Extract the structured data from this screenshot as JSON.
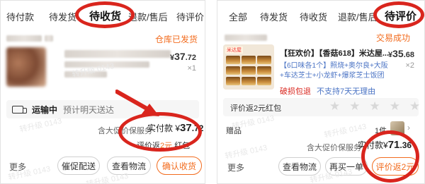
{
  "left": {
    "tabs": [
      "待付款",
      "待发货",
      "待收货",
      "退款/售后",
      "待评价"
    ],
    "status": "仓库已发货",
    "price": {
      "symbol": "¥",
      "integer": "37",
      "decimal": ".72"
    },
    "qty": "×1",
    "delivery": {
      "label": "运输中",
      "note": "预计明天送达"
    },
    "paid": {
      "prefix": "含大促价保服务",
      "label": "实付款",
      "symbol": "¥",
      "integer": "37",
      "decimal": ".72"
    },
    "reward": {
      "prefix": "评价返",
      "amount": "2元",
      "suffix": "红包"
    },
    "actions": {
      "more": "更多",
      "urge": "催促配送",
      "logistics": "查看物流",
      "confirm": "确认收货"
    },
    "watermarks": [
      "转升级 0143",
      "转升级 0143",
      "转升级 0143",
      "转升级 0143"
    ]
  },
  "right": {
    "tabs": [
      "全部",
      "待发货",
      "待收货",
      "退款/售后",
      "待评价"
    ],
    "status": "交易成功",
    "product": {
      "title": "【狂欢价】【香菇618】米达屋...",
      "option": "【6口味各1个】照烧+奥尔良+大阪+车达芝士+小龙虾+爆浆芝士饭团",
      "thumb_tag": "米达屋",
      "tags": {
        "red": "破损包退",
        "blue": "不支持7天无理由"
      },
      "price": {
        "symbol": "¥",
        "integer": "35",
        "decimal": ".68"
      },
      "qty": "×2"
    },
    "rating_label": "评价返2元红包",
    "gift": {
      "label": "赠品",
      "count": "1件"
    },
    "paid": {
      "prefix": "含大促价保服务",
      "label": "实付款",
      "symbol": "¥",
      "integer": "71",
      "decimal": ".36"
    },
    "actions": {
      "more": "更多",
      "logistics": "查看物流",
      "rebuy": "再买一单",
      "review": "评价返2元"
    },
    "watermarks": [
      "转升级 0143",
      "转升级 0143",
      "转升级 0143",
      "转升级 0143"
    ]
  },
  "colors": {
    "accent": "#f26b1d",
    "annotation": "#d9251d",
    "link": "#4a73c4"
  }
}
